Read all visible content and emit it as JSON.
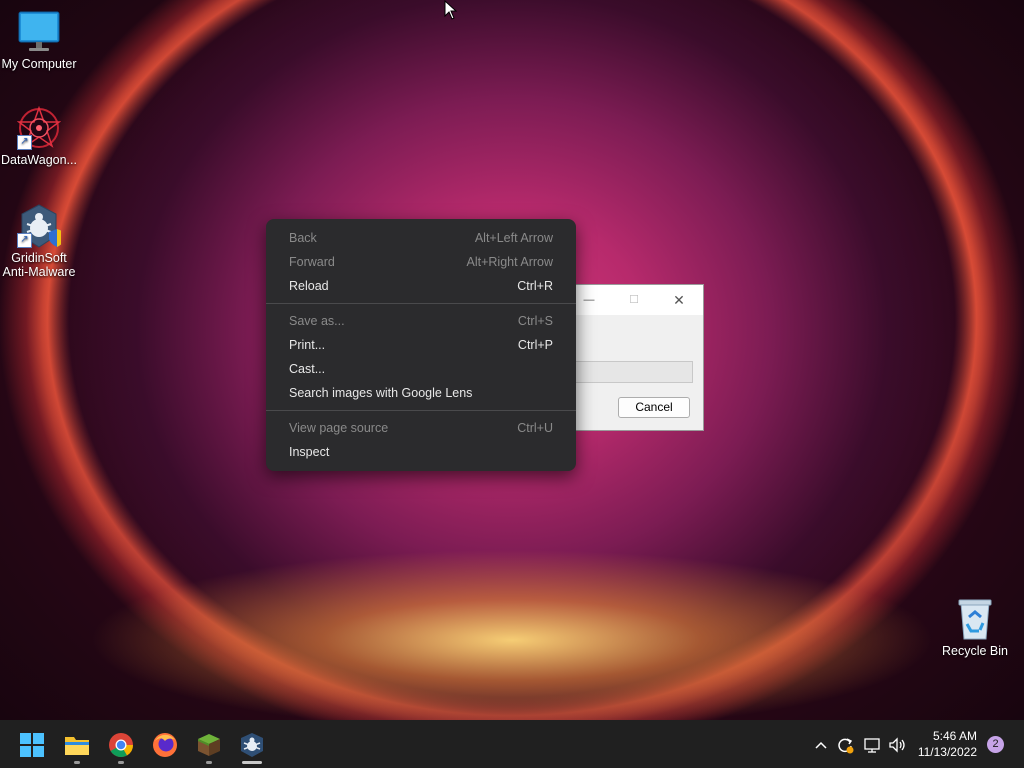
{
  "desktop": {
    "icons": [
      {
        "label": "My Computer",
        "icon": "monitor-icon"
      },
      {
        "label": "DataWagon...",
        "icon": "datawagon-logo-icon"
      },
      {
        "label": "GridinSoft\nAnti-Malware",
        "label_line1": "GridinSoft",
        "label_line2": "Anti-Malware",
        "icon": "gridinsoft-bug-shield-icon"
      },
      {
        "label": "Recycle Bin",
        "icon": "recycle-bin-icon"
      }
    ]
  },
  "dialog": {
    "cancel_label": "Cancel",
    "controls": {
      "minimize": "—",
      "maximize": "☐",
      "close": "✕"
    }
  },
  "context_menu": {
    "items": [
      {
        "label": "Back",
        "shortcut": "Alt+Left Arrow",
        "enabled": false
      },
      {
        "label": "Forward",
        "shortcut": "Alt+Right Arrow",
        "enabled": false
      },
      {
        "label": "Reload",
        "shortcut": "Ctrl+R",
        "enabled": true
      },
      {
        "label": "Save as...",
        "shortcut": "Ctrl+S",
        "enabled": false
      },
      {
        "label": "Print...",
        "shortcut": "Ctrl+P",
        "enabled": true
      },
      {
        "label": "Cast...",
        "shortcut": "",
        "enabled": true
      },
      {
        "label": "Search images with Google Lens",
        "shortcut": "",
        "enabled": true
      },
      {
        "label": "View page source",
        "shortcut": "Ctrl+U",
        "enabled": false
      },
      {
        "label": "Inspect",
        "shortcut": "",
        "enabled": true
      }
    ]
  },
  "taskbar": {
    "apps": [
      "start-icon",
      "file-explorer-icon",
      "chrome-icon",
      "firefox-icon",
      "minecraft-grass-block-icon",
      "gridinsoft-taskbar-icon"
    ],
    "tray": {
      "time": "5:46 AM",
      "date": "11/13/2022",
      "notification_count": "2",
      "icons": [
        "chevron-up-icon",
        "update-icon",
        "network-icon",
        "volume-icon"
      ]
    }
  },
  "colors": {
    "menu_bg": "#2b2b2d",
    "taskbar_bg": "#202020",
    "notification_badge": "#c7a4e8"
  }
}
